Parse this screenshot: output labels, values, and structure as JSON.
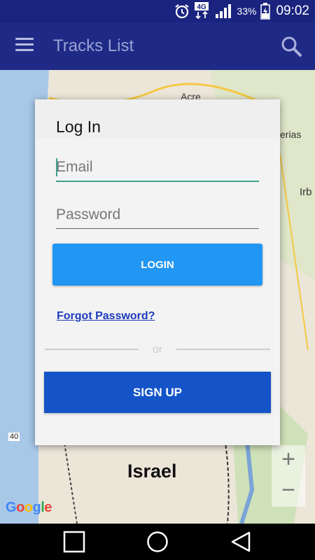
{
  "status_bar": {
    "network": "4G",
    "battery_percent": "33%",
    "time": "09:02",
    "icons": [
      "alarm-clock-icon",
      "data-4g-icon",
      "signal-icon",
      "battery-charging-icon"
    ]
  },
  "app_bar": {
    "title": "Tracks List",
    "icons": [
      "menu-icon",
      "search-icon"
    ]
  },
  "map": {
    "labels": {
      "acre": "Acre",
      "tiberias": "erias",
      "irbid": "Irb",
      "country": "Israel",
      "road": "40"
    },
    "attribution": "Google",
    "zoom_in": "+",
    "zoom_out": "−"
  },
  "dialog": {
    "title": "Log In",
    "email_placeholder": "Email",
    "email_value": "",
    "password_placeholder": "Password",
    "password_value": "",
    "login_label": "LOGIN",
    "forgot_label": "Forgot Password?",
    "divider_text": "or",
    "signup_label": "SIGN UP"
  },
  "nav_bar": {
    "icons": [
      "recents-square-icon",
      "home-circle-icon",
      "back-triangle-icon"
    ]
  },
  "colors": {
    "app_bar": "#1f2a86",
    "status_bar": "#1a237e",
    "login_button": "#2196f3",
    "signup_button": "#1454c8",
    "accent_underline": "#3aa38c",
    "link": "#1b3bbd"
  }
}
